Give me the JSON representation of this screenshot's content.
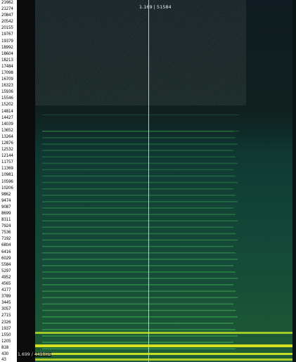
{
  "spectrogram": {
    "freq_ticks": [
      "21662",
      "21274",
      "20847",
      "20542",
      "20155",
      "19767",
      "19379",
      "18992",
      "18604",
      "18213",
      "17484",
      "17098",
      "16709",
      "16323",
      "15936",
      "15546",
      "15202",
      "14814",
      "14427",
      "14039",
      "13652",
      "13264",
      "12876",
      "12532",
      "12144",
      "11757",
      "11369",
      "10981",
      "10596",
      "10206",
      "9862",
      "9474",
      "9087",
      "8699",
      "8311",
      "7924",
      "7536",
      "7192",
      "6804",
      "6416",
      "6029",
      "5584",
      "5297",
      "4952",
      "4565",
      "4177",
      "3789",
      "3445",
      "3057",
      "2715",
      "2326",
      "1937",
      "1550",
      "1205",
      "818",
      "430",
      "43"
    ],
    "cursor_label": "1.169 | 51584",
    "readout": "1.699 / 4410Hz",
    "colors": {
      "low": "#0f1b20",
      "mid": "#124236",
      "high": "#d6e020",
      "band": "#3fae55"
    }
  }
}
